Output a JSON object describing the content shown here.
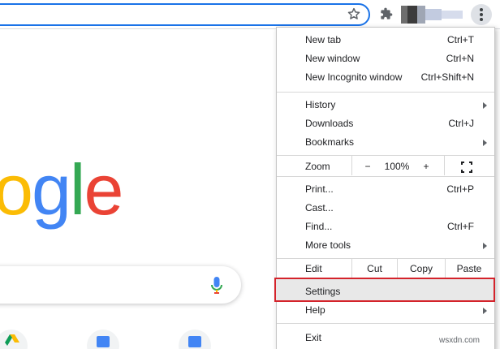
{
  "logo": {
    "o": "o",
    "g1": "g",
    "l": "l",
    "e": "e"
  },
  "menu": {
    "new_tab": {
      "label": "New tab",
      "shortcut": "Ctrl+T"
    },
    "new_window": {
      "label": "New window",
      "shortcut": "Ctrl+N"
    },
    "new_incognito": {
      "label": "New Incognito window",
      "shortcut": "Ctrl+Shift+N"
    },
    "history": {
      "label": "History"
    },
    "downloads": {
      "label": "Downloads",
      "shortcut": "Ctrl+J"
    },
    "bookmarks": {
      "label": "Bookmarks"
    },
    "zoom": {
      "label": "Zoom",
      "minus": "−",
      "level": "100%",
      "plus": "+"
    },
    "print": {
      "label": "Print...",
      "shortcut": "Ctrl+P"
    },
    "cast": {
      "label": "Cast..."
    },
    "find": {
      "label": "Find...",
      "shortcut": "Ctrl+F"
    },
    "more_tools": {
      "label": "More tools"
    },
    "edit": {
      "label": "Edit",
      "cut": "Cut",
      "copy": "Copy",
      "paste": "Paste"
    },
    "settings": {
      "label": "Settings"
    },
    "help": {
      "label": "Help"
    },
    "exit": {
      "label": "Exit"
    }
  },
  "watermark": "wsxdn.com",
  "icons": {
    "star": "star-icon",
    "extensions": "puzzle-icon",
    "menu": "kebab-icon",
    "mic": "mic-icon",
    "fullscreen": "fullscreen-icon"
  },
  "colors": {
    "accent": "#1a73e8",
    "highlight_border": "#d4232b",
    "google_blue": "#4285f4",
    "google_red": "#ea4335",
    "google_yellow": "#fbbc05",
    "google_green": "#34a853"
  }
}
